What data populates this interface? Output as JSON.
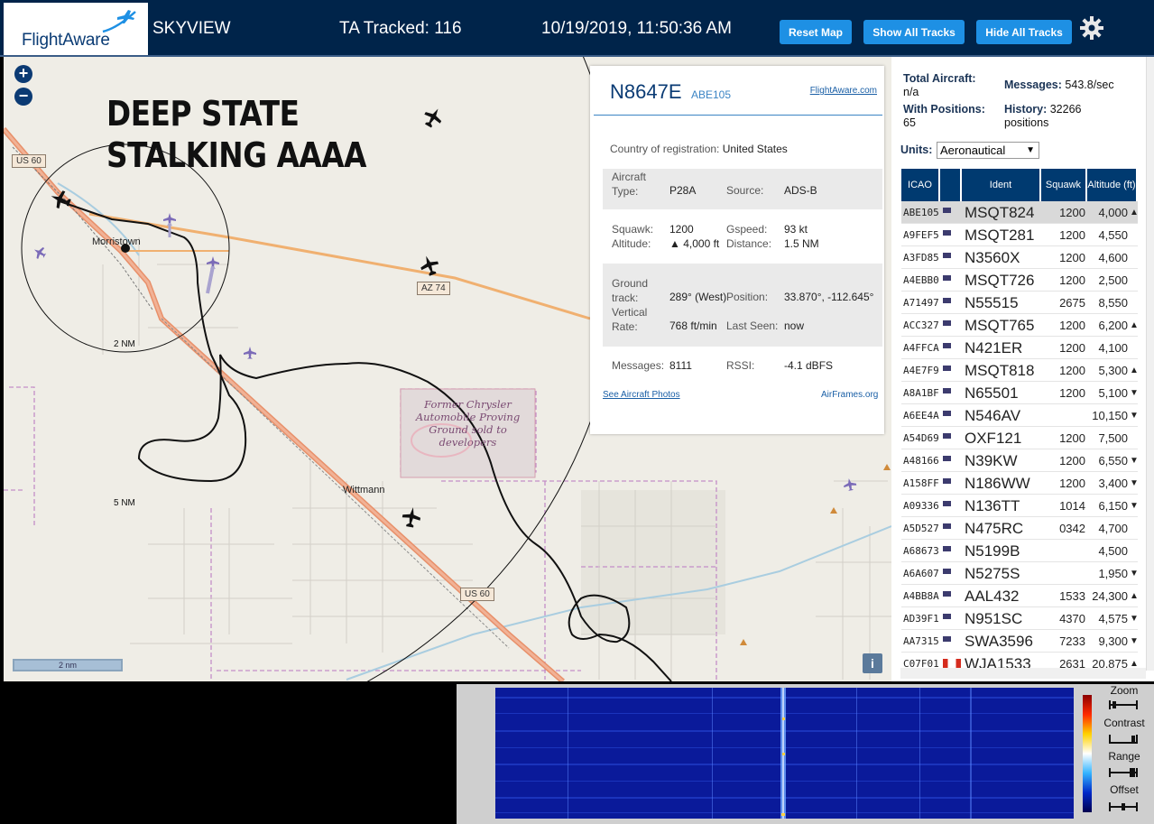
{
  "header": {
    "logo": "FlightAware",
    "app_name": "SKYVIEW",
    "tracked": "TA Tracked: 116",
    "datetime": "10/19/2019, 11:50:36 AM",
    "reset_map": "Reset Map",
    "show_all": "Show All Tracks",
    "hide_all": "Hide All Tracks"
  },
  "map": {
    "zoom_in": "+",
    "zoom_out": "−",
    "caption_line1": "DEEP STATE",
    "caption_line2": "STALKING AAAA",
    "road_us60": "US 60",
    "road_az74": "AZ 74",
    "town_morristown": "Morristown",
    "town_wittmann": "Wittmann",
    "ring_2nm": "2 NM",
    "ring_5nm": "5 NM",
    "proving_ground": "Former Chrysler Automobile Proving Ground sold to developers",
    "scale": "2 nm",
    "info": "i"
  },
  "popup": {
    "registration": "N8647E",
    "ident": "ABE105",
    "flightaware_link": "FlightAware.com",
    "country_label": "Country of registration:",
    "country": "United States",
    "aircraft_type_label": "Aircraft Type:",
    "aircraft_type": "P28A",
    "source_label": "Source:",
    "source": "ADS-B",
    "squawk_label": "Squawk:",
    "squawk": "1200",
    "gspeed_label": "Gspeed:",
    "gspeed": "93 kt",
    "altitude_label": "Altitude:",
    "altitude": "▲ 4,000 ft",
    "distance_label": "Distance:",
    "distance": "1.5 NM",
    "ground_track_label": "Ground track:",
    "ground_track": "289° (West)",
    "position_label": "Position:",
    "position": "33.870°, -112.645°",
    "vrate_label": "Vertical Rate:",
    "vrate": "768 ft/min",
    "last_seen_label": "Last Seen:",
    "last_seen": "now",
    "messages_label": "Messages:",
    "messages": "8111",
    "rssi_label": "RSSI:",
    "rssi": "-4.1 dBFS",
    "photos_link": "See Aircraft Photos",
    "airframes_link": "AirFrames.org"
  },
  "panel": {
    "total_label": "Total Aircraft:",
    "total_value": "n/a",
    "messages_label": "Messages:",
    "messages_value": "543.8/sec",
    "positions_label": "With Positions:",
    "positions_value": "65",
    "history_label": "History:",
    "history_value": "32266 positions",
    "units_label": "Units:",
    "units_value": "Aeronautical",
    "columns": [
      "ICAO",
      "",
      "Ident",
      "Squawk",
      "Altitude (ft)"
    ],
    "rows": [
      {
        "icao": "ABE105",
        "flag": "us",
        "ident": "MSQT824",
        "squawk": "1200",
        "alt": "4,000",
        "trend": "▲"
      },
      {
        "icao": "A9FEF5",
        "flag": "us",
        "ident": "MSQT281",
        "squawk": "1200",
        "alt": "4,550",
        "trend": ""
      },
      {
        "icao": "A3FD85",
        "flag": "us",
        "ident": "N3560X",
        "squawk": "1200",
        "alt": "4,600",
        "trend": ""
      },
      {
        "icao": "A4EBB0",
        "flag": "us",
        "ident": "MSQT726",
        "squawk": "1200",
        "alt": "2,500",
        "trend": ""
      },
      {
        "icao": "A71497",
        "flag": "us",
        "ident": "N55515",
        "squawk": "2675",
        "alt": "8,550",
        "trend": ""
      },
      {
        "icao": "ACC327",
        "flag": "us",
        "ident": "MSQT765",
        "squawk": "1200",
        "alt": "6,200",
        "trend": "▲"
      },
      {
        "icao": "A4FFCA",
        "flag": "us",
        "ident": "N421ER",
        "squawk": "1200",
        "alt": "4,100",
        "trend": ""
      },
      {
        "icao": "A4E7F9",
        "flag": "us",
        "ident": "MSQT818",
        "squawk": "1200",
        "alt": "5,300",
        "trend": "▲"
      },
      {
        "icao": "A8A1BF",
        "flag": "us",
        "ident": "N65501",
        "squawk": "1200",
        "alt": "5,100",
        "trend": "▼"
      },
      {
        "icao": "A6EE4A",
        "flag": "us",
        "ident": "N546AV",
        "squawk": "",
        "alt": "10,150",
        "trend": "▼"
      },
      {
        "icao": "A54D69",
        "flag": "us",
        "ident": "OXF121",
        "squawk": "1200",
        "alt": "7,500",
        "trend": ""
      },
      {
        "icao": "A48166",
        "flag": "us",
        "ident": "N39KW",
        "squawk": "1200",
        "alt": "6,550",
        "trend": "▼"
      },
      {
        "icao": "A158FF",
        "flag": "us",
        "ident": "N186WW",
        "squawk": "1200",
        "alt": "3,400",
        "trend": "▼"
      },
      {
        "icao": "A09336",
        "flag": "us",
        "ident": "N136TT",
        "squawk": "1014",
        "alt": "6,150",
        "trend": "▼"
      },
      {
        "icao": "A5D527",
        "flag": "us",
        "ident": "N475RC",
        "squawk": "0342",
        "alt": "4,700",
        "trend": ""
      },
      {
        "icao": "A68673",
        "flag": "us",
        "ident": "N5199B",
        "squawk": "",
        "alt": "4,500",
        "trend": ""
      },
      {
        "icao": "A6A607",
        "flag": "us",
        "ident": "N5275S",
        "squawk": "",
        "alt": "1,950",
        "trend": "▼"
      },
      {
        "icao": "A4BB8A",
        "flag": "us",
        "ident": "AAL432",
        "squawk": "1533",
        "alt": "24,300",
        "trend": "▲"
      },
      {
        "icao": "AD39F1",
        "flag": "us",
        "ident": "N951SC",
        "squawk": "4370",
        "alt": "4,575",
        "trend": "▼"
      },
      {
        "icao": "AA7315",
        "flag": "us",
        "ident": "SWA3596",
        "squawk": "7233",
        "alt": "9,300",
        "trend": "▼"
      },
      {
        "icao": "C07F01",
        "flag": "ca",
        "ident": "WJA1533",
        "squawk": "2631",
        "alt": "20,875",
        "trend": "▲"
      }
    ]
  },
  "spectrum": {
    "zoom": "Zoom",
    "contrast": "Contrast",
    "range": "Range",
    "offset": "Offset"
  }
}
